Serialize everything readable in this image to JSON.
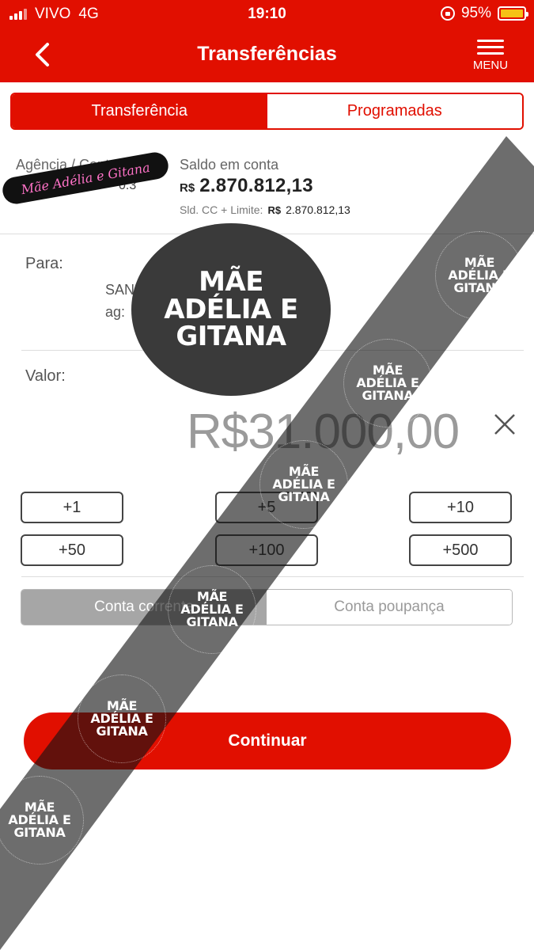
{
  "status_bar": {
    "carrier": "VIVO",
    "network": "4G",
    "time": "19:10",
    "battery": "95%"
  },
  "header": {
    "title": "Transferências",
    "menu_label": "MENU"
  },
  "tabs": {
    "items": [
      "Transferência",
      "Programadas"
    ],
    "selected": "Transferência"
  },
  "account": {
    "agency_label": "Agência / Conta",
    "agency_value": "0.3",
    "balance_label": "Saldo em conta",
    "currency": "R$",
    "balance": "2.870.812,13",
    "limit_label": "Sld. CC + Limite:",
    "limit_currency": "R$",
    "limit_value": "2.870.812,13"
  },
  "recipient": {
    "label": "Para:",
    "line1": "SAN",
    "line2": "ag:"
  },
  "amount": {
    "label": "Valor:",
    "value": "R$31.000,00"
  },
  "quick_buttons": [
    "+1",
    "+5",
    "+10",
    "+50",
    "+100",
    "+500"
  ],
  "account_type": {
    "options": [
      "Conta corrente",
      "Conta poupança"
    ],
    "selected": "Conta corrente"
  },
  "continue_label": "Continuar",
  "watermark": {
    "tag": "Mãe Adélia e Gitana",
    "line1": "MÃE",
    "line2": "ADÉLIA E",
    "line3": "GITANA"
  },
  "colors": {
    "brand_red": "#e10f00",
    "selected_grey": "#a6a6a6"
  }
}
